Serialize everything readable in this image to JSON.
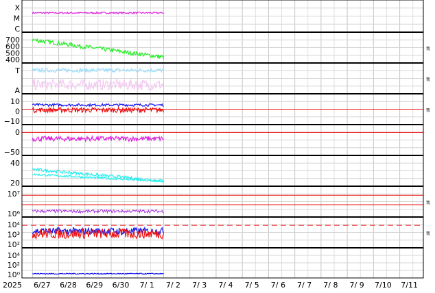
{
  "chart_data": {
    "type": "line",
    "x_start_label": "2025",
    "x_ticks": [
      "6/27",
      "6/28",
      "6/29",
      "6/30",
      "7/ 1",
      "7/ 2",
      "7/ 3",
      "7/ 4",
      "7/ 5",
      "7/ 6",
      "7/ 7",
      "7/ 8",
      "7/ 9",
      "7/10",
      "7/11"
    ],
    "data_extent_days": [
      0,
      5.0
    ],
    "x_range_days": [
      0,
      15.3
    ],
    "grid": true,
    "colors": {
      "magenta": "#dd22dd",
      "green": "#22ee22",
      "lightblue": "#99ddff",
      "pink": "#f2bbee",
      "blue": "#1111ee",
      "red": "#ee1111",
      "cyan": "#22eeee",
      "purple": "#9911dd"
    },
    "panels": [
      {
        "id": "xray",
        "ylabels": [
          "X",
          "M",
          "C"
        ],
        "series": [
          {
            "color": "magenta",
            "base": 0.62,
            "noise": 0.03
          }
        ],
        "marker": "",
        "hlines": []
      },
      {
        "id": "speed",
        "yticks": [
          "700",
          "600",
          "500",
          "400"
        ],
        "yrange": [
          370,
          780
        ],
        "series": [
          {
            "color": "green",
            "start": 700,
            "end": 420,
            "noise": 35
          }
        ],
        "marker": "π",
        "hlines": []
      },
      {
        "id": "ta",
        "ylabels": [
          "T",
          "A"
        ],
        "series": [
          {
            "color": "lightblue",
            "base": 0.82,
            "noise": 0.08
          },
          {
            "color": "pink",
            "base": 0.25,
            "noise": 0.22,
            "sparse": true
          }
        ],
        "marker": "π",
        "hlines": []
      },
      {
        "id": "bfield",
        "yticks": [
          "10",
          "0",
          "−10"
        ],
        "yrange": [
          -15,
          15
        ],
        "series": [
          {
            "color": "blue",
            "base": 5,
            "noise": 1.5
          },
          {
            "color": "red",
            "base": -1,
            "noise": 3
          }
        ],
        "marker": "π",
        "hlines": [
          {
            "value": 0,
            "color": "red"
          }
        ]
      },
      {
        "id": "angle",
        "yticks": [
          "0",
          "−50"
        ],
        "yrange": [
          -80,
          20
        ],
        "series": [
          {
            "color": "magenta",
            "base": -25,
            "noise": 10
          }
        ],
        "marker": "",
        "hlines": [
          {
            "value": 0,
            "color": "red"
          }
        ]
      },
      {
        "id": "density",
        "yticks": [
          "40",
          "20"
        ],
        "yrange": [
          0,
          50
        ],
        "series": [
          {
            "color": "cyan",
            "start": 28,
            "end": 5,
            "noise": 3
          },
          {
            "color": "cyan",
            "start": 18,
            "end": 4,
            "noise": 2
          }
        ],
        "marker": "",
        "hlines": []
      },
      {
        "id": "temp",
        "yticks": [
          "10⁷",
          "10⁶"
        ],
        "yrange": [
          0,
          1
        ],
        "series": [
          {
            "color": "purple",
            "base": 0.12,
            "noise": 0.06,
            "sparse": true
          }
        ],
        "marker": "π",
        "hlines": [
          {
            "value": 0.75,
            "color": "red"
          },
          {
            "value": 0.38,
            "color": "red"
          }
        ]
      },
      {
        "id": "flux",
        "yticks": [
          "10⁴",
          "10³",
          "10²"
        ],
        "yrange": [
          0,
          1
        ],
        "series": [
          {
            "color": "blue",
            "base": 0.55,
            "noise": 0.14
          },
          {
            "color": "red",
            "base": 0.45,
            "noise": 0.2
          }
        ],
        "marker": "π",
        "hlines": [
          {
            "value": 0.78,
            "color": "red",
            "dashed": true
          }
        ]
      },
      {
        "id": "electrons",
        "yticks": [
          "10⁴",
          "10²",
          "10⁰"
        ],
        "yrange": [
          0,
          1
        ],
        "series": [
          {
            "color": "blue",
            "base": 0.06,
            "noise": 0.02
          }
        ],
        "marker": "",
        "hlines": []
      }
    ]
  }
}
